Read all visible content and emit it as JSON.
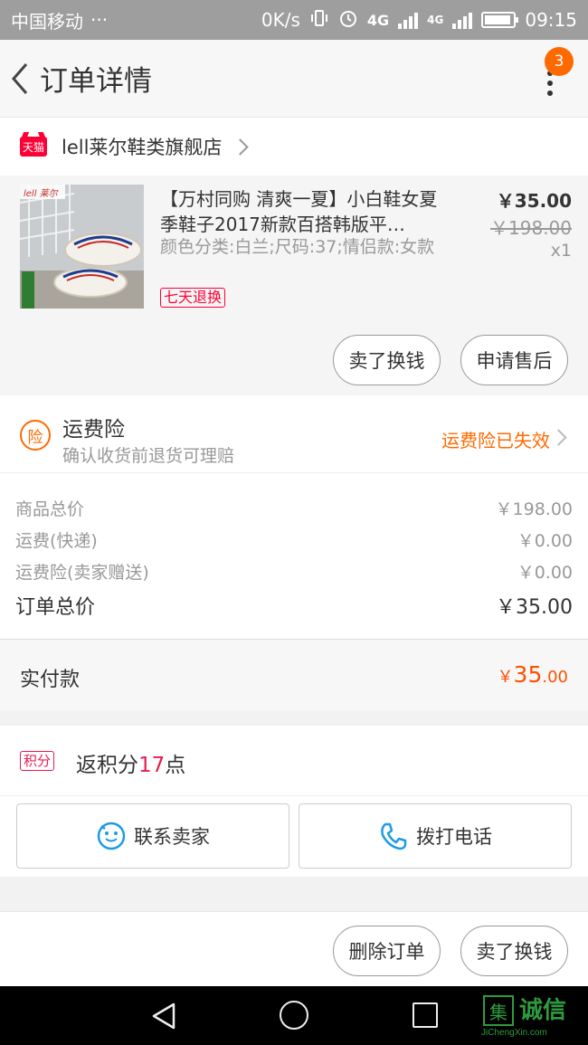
{
  "status_bar": {
    "carrier": "中国移动",
    "dots": "···",
    "speed": "0K/s",
    "network_1": "4G",
    "network_2": "4G",
    "time": "09:15"
  },
  "nav": {
    "title": "订单详情",
    "badge_count": "3"
  },
  "shop": {
    "logo_text": "天猫",
    "name": "lell莱尔鞋类旗舰店"
  },
  "product": {
    "image_brand": "lell 莱尔",
    "title": "【万村同购 清爽一夏】小白鞋女夏季鞋子2017新款百搭韩版平…",
    "spec": "颜色分类:白兰;尺码:37;情侣款:女款",
    "tag": "七天退换",
    "price": "￥35.00",
    "original_price": "￥198.00",
    "quantity": "x1",
    "buttons": {
      "sell": "卖了换钱",
      "after_sale": "申请售后"
    }
  },
  "insurance": {
    "icon_text": "险",
    "title": "运费险",
    "subtitle": "确认收货前退货可理赔",
    "status": "运费险已失效"
  },
  "prices": [
    {
      "label": "商品总价",
      "value": "￥198.00"
    },
    {
      "label": "运费(快递)",
      "value": "￥0.00"
    },
    {
      "label": "运费险(卖家赠送)",
      "value": "￥0.00"
    },
    {
      "label": "订单总价",
      "value": "￥35.00"
    }
  ],
  "paid": {
    "label": "实付款",
    "currency": "￥",
    "amount_int": "35",
    "amount_dec": ".00"
  },
  "points": {
    "tag": "积分",
    "prefix": "返积分",
    "value": "17",
    "suffix": "点"
  },
  "contact": {
    "seller": "联系卖家",
    "call": "拨打电话"
  },
  "bottom_actions": {
    "delete": "删除订单",
    "sell": "卖了换钱"
  },
  "watermark": {
    "logo": "集",
    "text": "诚信",
    "sub": "JiChengXin.com"
  },
  "colors": {
    "accent": "#ff6a00",
    "price_red": "#ff5000",
    "tmall_red": "#ff0036",
    "points_red": "#e61e50",
    "status_bar": "#9e9e9e"
  }
}
